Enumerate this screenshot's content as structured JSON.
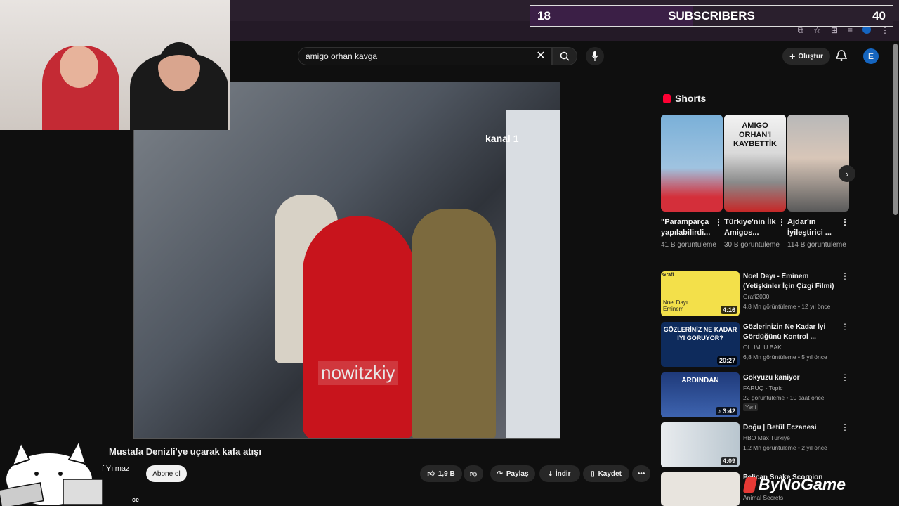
{
  "subscribers": {
    "current": "18",
    "label": "SUBSCRIBERS",
    "goal": "40"
  },
  "search": {
    "value": "amigo orhan kavga"
  },
  "header": {
    "create_label": "Oluştur",
    "avatar_letter": "E"
  },
  "video": {
    "overlay_text": "nowitzkiy",
    "channel_logo": "kanal 1",
    "title": "Mustafa Denizli'ye uçarak kafa atışı",
    "channel": "f Yılmaz",
    "subscribe_label": "Abone ol",
    "likes": "1,9 B",
    "share_label": "Paylaş",
    "download_label": "İndir",
    "save_label": "Kaydet",
    "desc_label": "ce"
  },
  "shorts": {
    "heading": "Shorts",
    "items": [
      {
        "title": "\"Paramparça yapılabilirdi...",
        "views": "41 B görüntüleme",
        "thumb_text": ""
      },
      {
        "title": "Türkiye'nin İlk Amigos...",
        "views": "30 B görüntüleme",
        "thumb_text": "AMIGO ORHAN'I KAYBETTİK"
      },
      {
        "title": "Ajdar'ın İyileştirici ...",
        "views": "114 B görüntüleme",
        "thumb_text": ""
      }
    ]
  },
  "related": [
    {
      "title": "Noel Dayı - Eminem (Yetişkinler İçin Çizgi Filmi)",
      "channel": "Grafi2000",
      "meta": "4,8 Mn görüntüleme • 12 yıl önce",
      "duration": "4:16",
      "thumb_text": "Noel Dayı Eminem",
      "thumb_label": "Grafi"
    },
    {
      "title": "Gözlerinizin Ne Kadar İyi Gördüğünü Kontrol ...",
      "channel": "OLUMLU BAK",
      "meta": "6,8 Mn görüntüleme • 5 yıl önce",
      "duration": "20:27",
      "thumb_text": "GÖZLERİNİZ NE KADAR İYİ GÖRÜYOR?"
    },
    {
      "title": "Gokyuzu kaniyor",
      "channel": "FARUQ - Topic",
      "meta": "22 görüntüleme • 10 saat önce",
      "duration": "♪ 3:42",
      "thumb_text": "ARDINDAN",
      "badge": "Yeni"
    },
    {
      "title": "Doğu | Betül Eczanesi",
      "channel": "HBO Max Türkiye",
      "meta": "1,2 Mn görüntüleme • 2 yıl önce",
      "duration": "4:09",
      "thumb_text": ""
    },
    {
      "title": "Pelican Snake Scorpion",
      "channel": "Animal Secrets",
      "meta": "",
      "duration": "",
      "thumb_text": ""
    }
  ],
  "overlay": {
    "brand": "ByNoGame"
  }
}
